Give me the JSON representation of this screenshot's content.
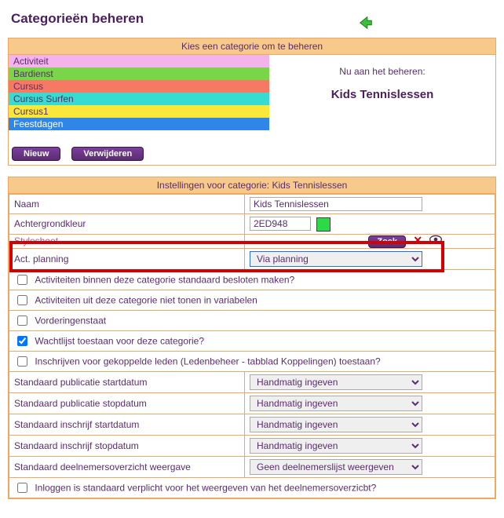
{
  "page_title": "Categorieën beheren",
  "selector": {
    "header": "Kies een categorie om te beheren",
    "now_editing_label": "Nu aan het beheren:",
    "current": "Kids Tennislessen",
    "categories": [
      {
        "label": "Activiteit",
        "bg": "#f4b3eb"
      },
      {
        "label": "Bardienst",
        "bg": "#79d648"
      },
      {
        "label": "Cursus",
        "bg": "#f67a63"
      },
      {
        "label": "Cursus Surfen",
        "bg": "#38dbd0"
      },
      {
        "label": "Cursus1",
        "bg": "#f9e83a"
      },
      {
        "label": "Feestdagen",
        "bg": "#2f86e8"
      }
    ],
    "btn_new": "Nieuw",
    "btn_delete": "Verwijderen"
  },
  "settings": {
    "header": "Instellingen voor categorie: Kids Tennislessen",
    "name_label": "Naam",
    "name_value": "Kids Tennislessen",
    "bgcolor_label": "Achtergrondkleur",
    "bgcolor_value": "2ED948",
    "bgcolor_swatch": "#2ED948",
    "stylesheet_label": "Stylesheet",
    "zoek_label": "Zoek",
    "actplanning_label": "Act. planning",
    "actplanning_value": "Via planning",
    "chk_besloten": "Activiteiten binnen deze categorie standaard besloten maken?",
    "chk_niet_tonen": "Activiteiten uit deze categorie niet tonen in variabelen",
    "chk_vorderingen": "Vorderingenstaat",
    "chk_wachtlijst": "Wachtlijst toestaan voor deze categorie?",
    "chk_inschrijven": "Inschrijven voor gekoppelde leden (Ledenbeheer - tabblad Koppelingen) toestaan?",
    "pub_start_label": "Standaard publicatie startdatum",
    "pub_start_value": "Handmatig ingeven",
    "pub_stop_label": "Standaard publicatie stopdatum",
    "pub_stop_value": "Handmatig ingeven",
    "insch_start_label": "Standaard inschrijf startdatum",
    "insch_start_value": "Handmatig ingeven",
    "insch_stop_label": "Standaard inschrijf stopdatum",
    "insch_stop_value": "Handmatig ingeven",
    "deelnemers_label": "Standaard deelnemersoverzicht weergave",
    "deelnemers_value": "Geen deelnemerslijst weergeven",
    "chk_inloggen": "Inloggen is standaard verplicht voor het weergeven van het deelnemersoverzicbt?"
  }
}
